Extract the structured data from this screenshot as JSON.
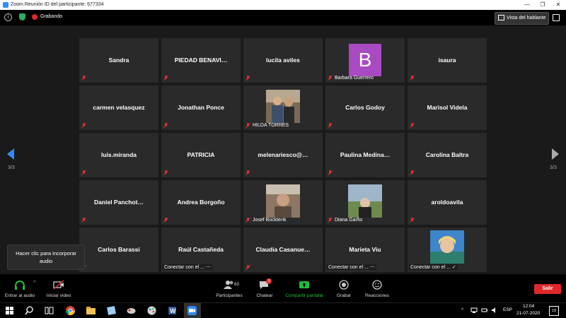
{
  "window": {
    "title": "Zoom Reunión ID del participante: 677334",
    "minimize": "—",
    "maximize": "❐",
    "close": "✕"
  },
  "topbar": {
    "info_glyph": "i",
    "recording_label": "Grabando",
    "speaker_view_label": "Vista del hablante"
  },
  "participants": [
    [
      "Sandra",
      "PIEDAD BENAVI…",
      "lucila aviles",
      "Barbara Guerrero",
      "isaura"
    ],
    [
      "carmen velasquez",
      "Jonathan Ponce",
      "HILDA TORRES",
      "Carlos Godoy",
      "Marisol Videla"
    ],
    [
      "luis.miranda",
      "PATRICIA",
      "melenariesco@…",
      "Paulina  Medina…",
      "Carolina Baltra"
    ],
    [
      "Daniel  Panchot…",
      "Andrea Borgoño",
      "Josef Bocktenk",
      "Diana Garfio",
      "aroldoavila"
    ],
    [
      "Carlos Barassi",
      "Raúl Castañeda",
      "Claudia  Casanue…",
      "Marieta Viu",
      ""
    ]
  ],
  "avatar_letter": "B",
  "connecting": {
    "raul": "Conectar con el ... ⋯",
    "marieta": "Conectar con el ... ⋯",
    "last": "Conectar con el ... ✓"
  },
  "paging": {
    "left": "3/3",
    "right": "3/3"
  },
  "tooltip": {
    "line1": "Hacer clic para incorporar",
    "line2": "audio"
  },
  "toolbar": {
    "audio": "Entrar al audio",
    "video": "Iniciar video",
    "participants": "Participantes",
    "participants_count": "60",
    "chat": "Chatear",
    "chat_badge": "3",
    "share": "Compartir pantalla",
    "record": "Grabar",
    "reactions": "Reacciones",
    "leave": "Salir"
  },
  "taskbar": {
    "lang": "ESP",
    "time": "12:04",
    "date": "21-07-2020",
    "notif": "19"
  },
  "colors": {
    "accent": "#2D8CFF",
    "record": "#e02828",
    "share": "#1fbf3a",
    "avatar": "#a94ac2"
  }
}
